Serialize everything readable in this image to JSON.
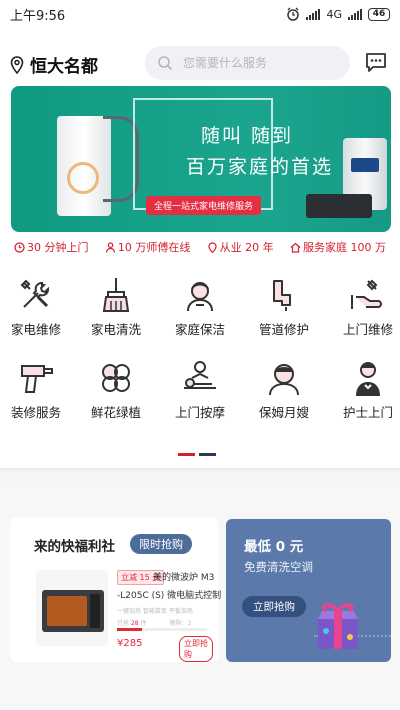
{
  "status_bar": {
    "time": "上午9:56",
    "network": "4G",
    "battery": "46"
  },
  "header": {
    "location": "恒大名都",
    "search_placeholder": "您需要什么服务"
  },
  "banner": {
    "line1": "随叫 随到",
    "line2": "百万家庭的首选",
    "tag": "全程一站式家电维修服务"
  },
  "features": [
    {
      "icon": "clock-icon",
      "label": "30 分钟上门"
    },
    {
      "icon": "worker-icon",
      "label": "10 万师傅在线"
    },
    {
      "icon": "location-icon",
      "label": "从业 20 年"
    },
    {
      "icon": "house-icon",
      "label": "服务家庭 100 万"
    }
  ],
  "services": [
    {
      "icon": "tools-icon",
      "label": "家电维修"
    },
    {
      "icon": "broom-icon",
      "label": "家电清洗"
    },
    {
      "icon": "maid-icon",
      "label": "家庭保洁"
    },
    {
      "icon": "pipe-icon",
      "label": "管道修护"
    },
    {
      "icon": "repair-hand-icon",
      "label": "上门维修"
    },
    {
      "icon": "drill-icon",
      "label": "装修服务"
    },
    {
      "icon": "clover-icon",
      "label": "鲜花绿植"
    },
    {
      "icon": "massage-icon",
      "label": "上门按摩"
    },
    {
      "icon": "nanny-icon",
      "label": "保姆月嫂"
    },
    {
      "icon": "nurse-icon",
      "label": "护士上门"
    }
  ],
  "welfare": {
    "title": "来的快福利社",
    "tag": "限时抢购",
    "product": {
      "discount": "立减 15 元",
      "name_line1": "美的微波炉 M3",
      "name_line2": "-L205C (S) 微电脑式控制",
      "subtitle": "一键加热 智能菜单 平板加热",
      "sold_label": "已抢",
      "sold_count": "28",
      "sold_unit": "件",
      "limit": "限购：3",
      "sold_ratio": 0.28,
      "price": "¥285",
      "buy": "立即抢购"
    }
  },
  "promo": {
    "title": "最低 0 元",
    "subtitle": "免费清洗空调",
    "button": "立即抢购"
  },
  "colors": {
    "accent": "#d5202f",
    "banner": "#16a088",
    "promo": "#5b79ab",
    "tag": "#4e6c9a"
  }
}
